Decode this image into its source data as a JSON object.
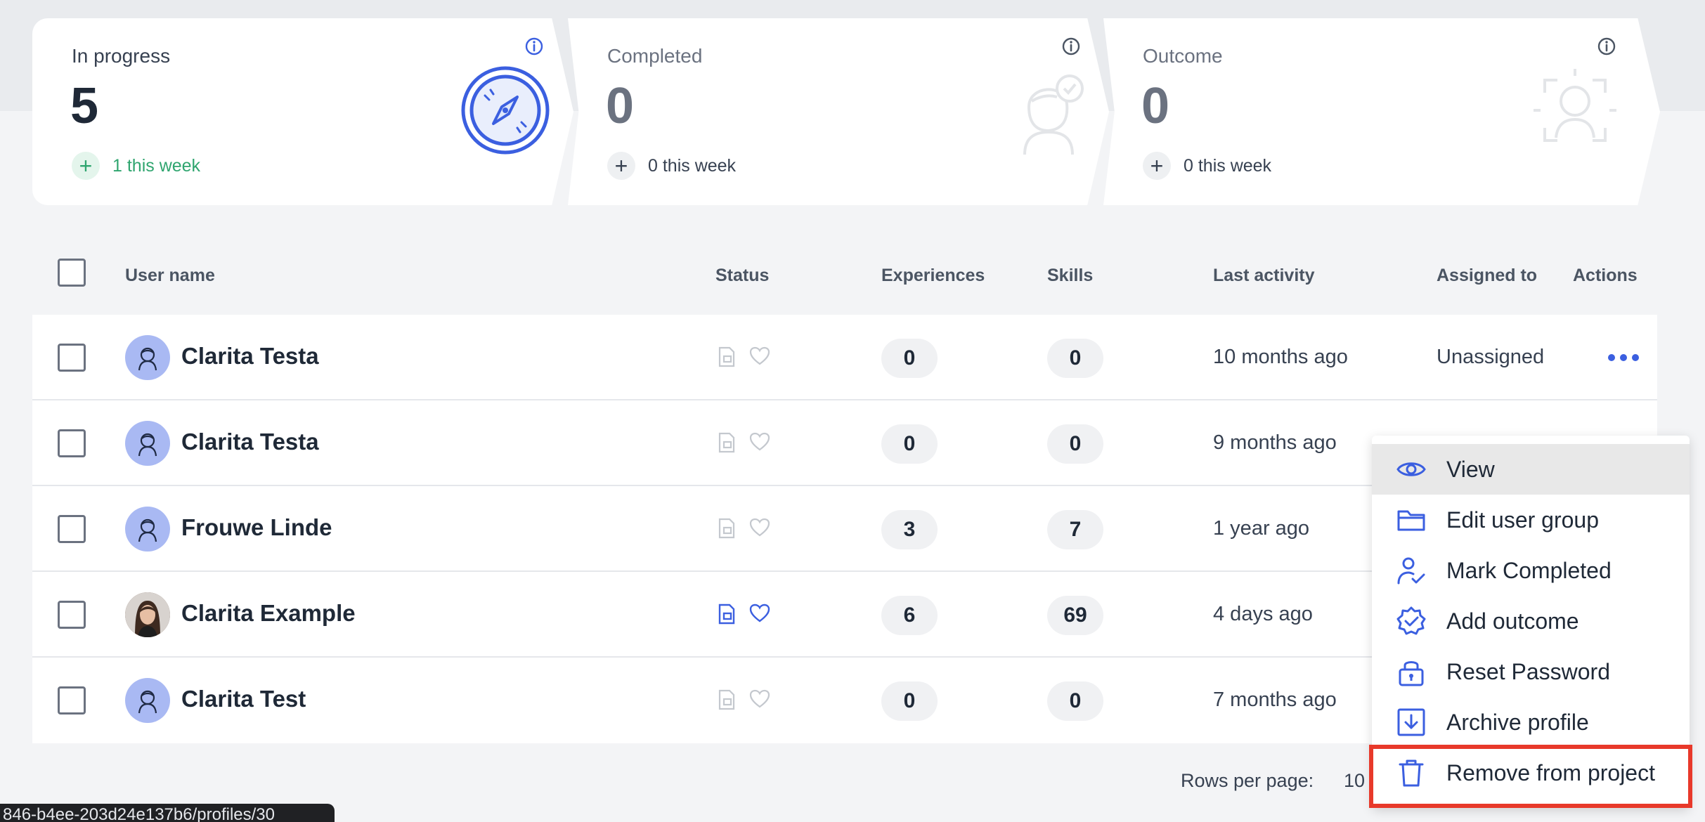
{
  "stats": [
    {
      "label": "In progress",
      "value": "5",
      "week": "1 this week"
    },
    {
      "label": "Completed",
      "value": "0",
      "week": "0 this week"
    },
    {
      "label": "Outcome",
      "value": "0",
      "week": "0 this week"
    }
  ],
  "table": {
    "headers": {
      "user_name": "User name",
      "status": "Status",
      "experiences": "Experiences",
      "skills": "Skills",
      "last_activity": "Last activity",
      "assigned_to": "Assigned to",
      "actions": "Actions"
    },
    "rows": [
      {
        "name": "Clarita Testa",
        "experiences": "0",
        "skills": "0",
        "last_activity": "10 months ago",
        "assigned_to": "Unassigned"
      },
      {
        "name": "Clarita Testa",
        "experiences": "0",
        "skills": "0",
        "last_activity": "9 months ago"
      },
      {
        "name": "Frouwe Linde",
        "experiences": "3",
        "skills": "7",
        "last_activity": "1 year ago"
      },
      {
        "name": "Clarita Example",
        "experiences": "6",
        "skills": "69",
        "last_activity": "4 days ago"
      },
      {
        "name": "Clarita Test",
        "experiences": "0",
        "skills": "0",
        "last_activity": "7 months ago"
      }
    ]
  },
  "menu": {
    "items": [
      {
        "label": "View",
        "icon": "eye-icon"
      },
      {
        "label": "Edit user group",
        "icon": "folder-icon"
      },
      {
        "label": "Mark Completed",
        "icon": "user-check-icon"
      },
      {
        "label": "Add outcome",
        "icon": "badge-check-icon"
      },
      {
        "label": "Reset Password",
        "icon": "lock-icon"
      },
      {
        "label": "Archive profile",
        "icon": "archive-download-icon"
      },
      {
        "label": "Remove from project",
        "icon": "trash-icon"
      }
    ]
  },
  "pagination": {
    "rows_per_page_label": "Rows per page:",
    "rows_per_page_value": "10"
  },
  "status_url": "846-b4ee-203d24e137b6/profiles/30",
  "colors": {
    "accent": "#3b5fe0",
    "green": "#2fa56f",
    "highlight": "#e8392a"
  }
}
